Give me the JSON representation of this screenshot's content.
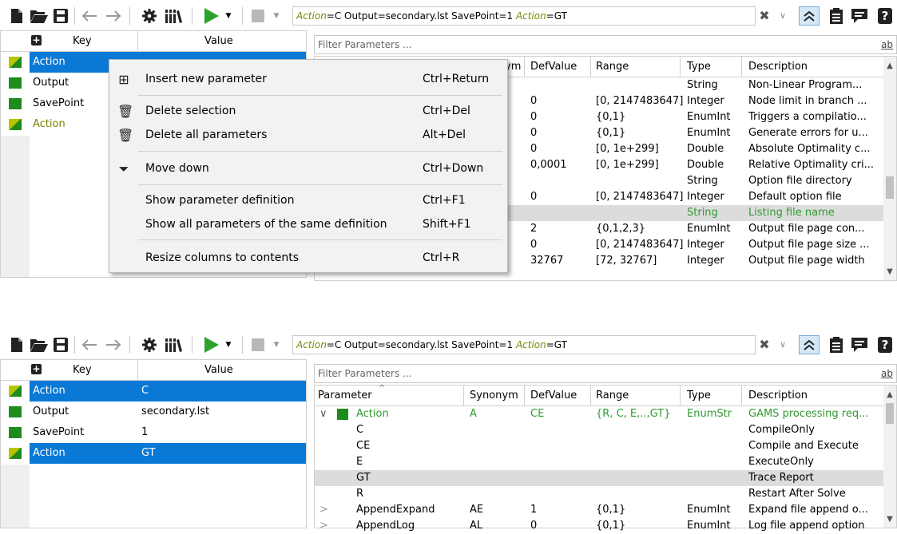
{
  "toolbar": {
    "command_parts": [
      {
        "text": "Action",
        "kw": true
      },
      {
        "text": "=C Output=secondary.lst SavePoint=1 ",
        "kw": false
      },
      {
        "text": "Action",
        "kw": true
      },
      {
        "text": "=GT",
        "kw": false
      }
    ],
    "clear_glyph": "✖",
    "dropdown_glyph": "∨",
    "help_glyph": "?"
  },
  "kv_table": {
    "headers": {
      "key": "Key",
      "value": "Value"
    },
    "top_rows": [
      {
        "key": "Action",
        "value": "",
        "flag": "mixed",
        "selected": true,
        "dup": false
      },
      {
        "key": "Output",
        "value": "",
        "flag": "green",
        "selected": false,
        "dup": false
      },
      {
        "key": "SavePoint",
        "value": "",
        "flag": "green",
        "selected": false,
        "dup": false
      },
      {
        "key": "Action",
        "value": "",
        "flag": "mixed",
        "selected": false,
        "dup": true
      }
    ],
    "bottom_rows": [
      {
        "key": "Action",
        "value": "C",
        "flag": "mixed",
        "selected": true
      },
      {
        "key": "Output",
        "value": "secondary.lst",
        "flag": "green",
        "selected": false
      },
      {
        "key": "SavePoint",
        "value": "1",
        "flag": "green",
        "selected": false
      },
      {
        "key": "Action",
        "value": "GT",
        "flag": "mixed",
        "selected": true
      }
    ]
  },
  "filter": {
    "placeholder": "Filter Parameters ...",
    "icon_text": "ab"
  },
  "defs_top": {
    "headers": [
      "ym",
      "DefValue",
      "Range",
      "Type",
      "Description"
    ],
    "rows": [
      {
        "def": "",
        "range": "",
        "type": "String",
        "desc": "Non-Linear Program...",
        "hl": false
      },
      {
        "def": "0",
        "range": "[0, 2147483647]",
        "type": "Integer",
        "desc": "Node limit in branch ...",
        "hl": false
      },
      {
        "def": "0",
        "range": "{0,1}",
        "type": "EnumInt",
        "desc": "Triggers a compilatio...",
        "hl": false
      },
      {
        "def": "0",
        "range": "{0,1}",
        "type": "EnumInt",
        "desc": "Generate errors for u...",
        "hl": false
      },
      {
        "def": "0",
        "range": "[0, 1e+299]",
        "type": "Double",
        "desc": "Absolute Optimality c...",
        "hl": false
      },
      {
        "def": "0,0001",
        "range": "[0, 1e+299]",
        "type": "Double",
        "desc": "Relative Optimality cri...",
        "hl": false
      },
      {
        "def": "",
        "range": "",
        "type": "String",
        "desc": "Option file directory",
        "hl": false
      },
      {
        "def": "0",
        "range": "[0, 2147483647]",
        "type": "Integer",
        "desc": "Default option file",
        "hl": false
      },
      {
        "def": "",
        "range": "",
        "type": "String",
        "desc": "Listing file name",
        "hl": true
      },
      {
        "def": "2",
        "range": "{0,1,2,3}",
        "type": "EnumInt",
        "desc": "Output file page con...",
        "hl": false
      },
      {
        "def": "0",
        "range": "[0, 2147483647]",
        "type": "Integer",
        "desc": "Output file page size ...",
        "hl": false
      },
      {
        "def": "32767",
        "range": "[72, 32767]",
        "type": "Integer",
        "desc": "Output file page width",
        "hl": false
      }
    ]
  },
  "defs_bottom": {
    "headers": [
      "Parameter",
      "Synonym",
      "DefValue",
      "Range",
      "Type",
      "Description"
    ],
    "rows": [
      {
        "expander": "∨",
        "flag": true,
        "param": "Action",
        "syn": "A",
        "def": "CE",
        "range": "{R, C, E,..,GT}",
        "type": "EnumStr",
        "desc": "GAMS processing req...",
        "green": true,
        "hl": false,
        "child": false
      },
      {
        "expander": "",
        "flag": false,
        "param": "C",
        "syn": "",
        "def": "",
        "range": "",
        "type": "",
        "desc": "CompileOnly",
        "green": false,
        "hl": false,
        "child": true
      },
      {
        "expander": "",
        "flag": false,
        "param": "CE",
        "syn": "",
        "def": "",
        "range": "",
        "type": "",
        "desc": "Compile and Execute",
        "green": false,
        "hl": false,
        "child": true
      },
      {
        "expander": "",
        "flag": false,
        "param": "E",
        "syn": "",
        "def": "",
        "range": "",
        "type": "",
        "desc": "ExecuteOnly",
        "green": false,
        "hl": false,
        "child": true
      },
      {
        "expander": "",
        "flag": false,
        "param": "GT",
        "syn": "",
        "def": "",
        "range": "",
        "type": "",
        "desc": "Trace Report",
        "green": false,
        "hl": true,
        "child": true
      },
      {
        "expander": "",
        "flag": false,
        "param": "R",
        "syn": "",
        "def": "",
        "range": "",
        "type": "",
        "desc": "Restart After Solve",
        "green": false,
        "hl": false,
        "child": true
      },
      {
        "expander": ">",
        "flag": false,
        "param": "AppendExpand",
        "syn": "AE",
        "def": "1",
        "range": "{0,1}",
        "type": "EnumInt",
        "desc": "Expand file append o...",
        "green": false,
        "hl": false,
        "child": false
      },
      {
        "expander": ">",
        "flag": false,
        "param": "AppendLog",
        "syn": "AL",
        "def": "0",
        "range": "{0,1}",
        "type": "EnumInt",
        "desc": "Log file append option",
        "green": false,
        "hl": false,
        "child": false
      }
    ]
  },
  "context_menu": {
    "items": [
      {
        "icon": "plus-square-icon",
        "glyph": "⊞",
        "label": "Insert new parameter",
        "shortcut": "Ctrl+Return"
      },
      {
        "icon": "trash-icon",
        "glyph": "🗑",
        "label": "Delete selection",
        "shortcut": "Ctrl+Del"
      },
      {
        "icon": "trash-icon",
        "glyph": "🗑",
        "label": "Delete all parameters",
        "shortcut": "Alt+Del"
      },
      {
        "icon": "move-down-icon",
        "glyph": "⏷",
        "label": "Move down",
        "shortcut": "Ctrl+Down"
      },
      {
        "icon": "",
        "glyph": "",
        "label": "Show parameter definition",
        "shortcut": "Ctrl+F1"
      },
      {
        "icon": "",
        "glyph": "",
        "label": "Show all parameters of the same definition",
        "shortcut": "Shift+F1"
      },
      {
        "icon": "",
        "glyph": "",
        "label": "Resize columns to contents",
        "shortcut": "Ctrl+R"
      }
    ]
  },
  "colors": {
    "selection": "#0a79d6",
    "flag_green": "#1d8c1d",
    "flag_yellow": "#b8c400",
    "keyword": "#6f8f00",
    "param_green": "#2e9a2e",
    "run": "#2ea22e"
  }
}
